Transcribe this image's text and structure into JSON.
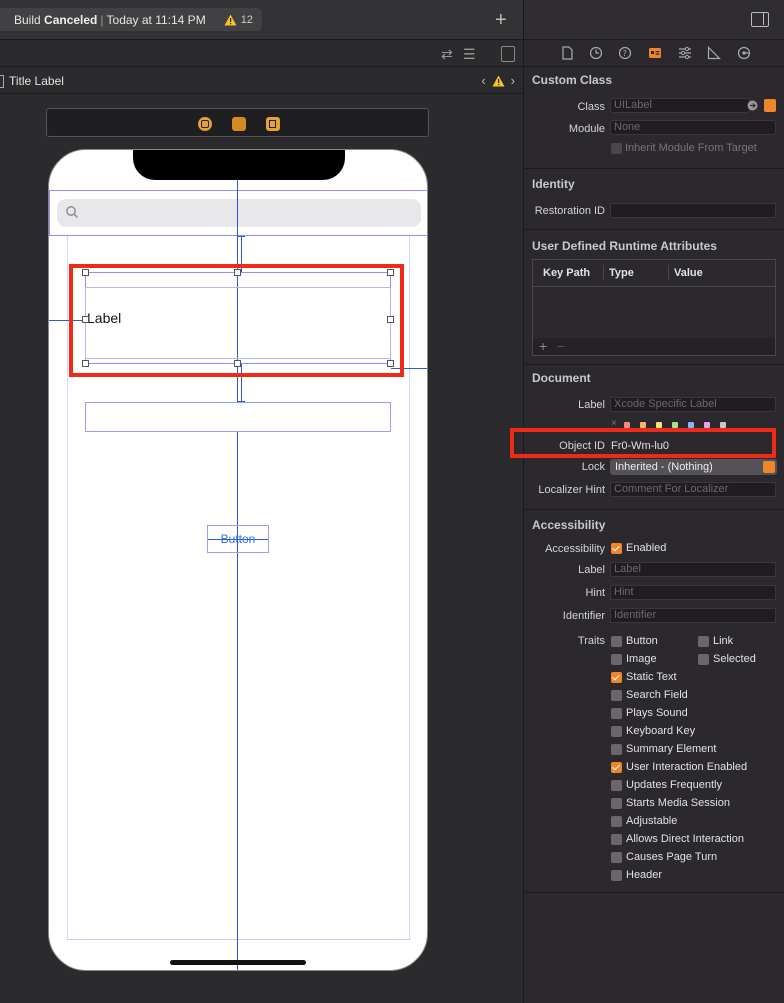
{
  "status": {
    "build_prefix": "Build",
    "build_result": "Canceled",
    "separator": "|",
    "time": "Today at 11:14 PM",
    "warning_count": "12"
  },
  "jumpbar": {
    "title": "Title Label"
  },
  "canvas": {
    "label_text": "Label",
    "button_text": "Button"
  },
  "inspector": {
    "custom_class": {
      "header": "Custom Class",
      "class_label": "Class",
      "class_value": "UILabel",
      "module_label": "Module",
      "module_value": "None",
      "inherit_label": "Inherit Module From Target"
    },
    "identity": {
      "header": "Identity",
      "restoration_label": "Restoration ID"
    },
    "runtime": {
      "header": "User Defined Runtime Attributes",
      "columns": [
        "Key Path",
        "Type",
        "Value"
      ],
      "add": "+",
      "remove": "−"
    },
    "document": {
      "header": "Document",
      "label_label": "Label",
      "label_placeholder": "Xcode Specific Label",
      "x_mark": "×",
      "object_id_label": "Object ID",
      "object_id_value": "Fr0-Wm-lu0",
      "lock_label": "Lock",
      "lock_value": "Inherited - (Nothing)",
      "localizer_label": "Localizer Hint",
      "localizer_placeholder": "Comment For Localizer"
    },
    "accessibility": {
      "header": "Accessibility",
      "acc_label": "Accessibility",
      "enabled_label": "Enabled",
      "label_label": "Label",
      "label_placeholder": "Label",
      "hint_label": "Hint",
      "hint_placeholder": "Hint",
      "identifier_label": "Identifier",
      "identifier_placeholder": "Identifier",
      "traits_label": "Traits",
      "traits": [
        {
          "name": "Button",
          "checked": false
        },
        {
          "name": "Link",
          "checked": false
        },
        {
          "name": "Image",
          "checked": false
        },
        {
          "name": "Selected",
          "checked": false
        },
        {
          "name": "Static Text",
          "checked": true
        },
        {
          "name": "Search Field",
          "checked": false
        },
        {
          "name": "Plays Sound",
          "checked": false
        },
        {
          "name": "Keyboard Key",
          "checked": false
        },
        {
          "name": "Summary Element",
          "checked": false
        },
        {
          "name": "User Interaction Enabled",
          "checked": true
        },
        {
          "name": "Updates Frequently",
          "checked": false
        },
        {
          "name": "Starts Media Session",
          "checked": false
        },
        {
          "name": "Adjustable",
          "checked": false
        },
        {
          "name": "Allows Direct Interaction",
          "checked": false
        },
        {
          "name": "Causes Page Turn",
          "checked": false
        },
        {
          "name": "Header",
          "checked": false
        }
      ]
    }
  },
  "colors": {
    "accent": "#f0862c",
    "highlight": "#ee2a19",
    "constraint": "#2b59d9",
    "frame": "#8f8ff5",
    "link_text": "#2e6fe6",
    "swatches": [
      "#f28b82",
      "#f6b26b",
      "#f9e27a",
      "#a8e28e",
      "#8ab4f8",
      "#e3a1f0",
      "#c8c8c8"
    ]
  }
}
